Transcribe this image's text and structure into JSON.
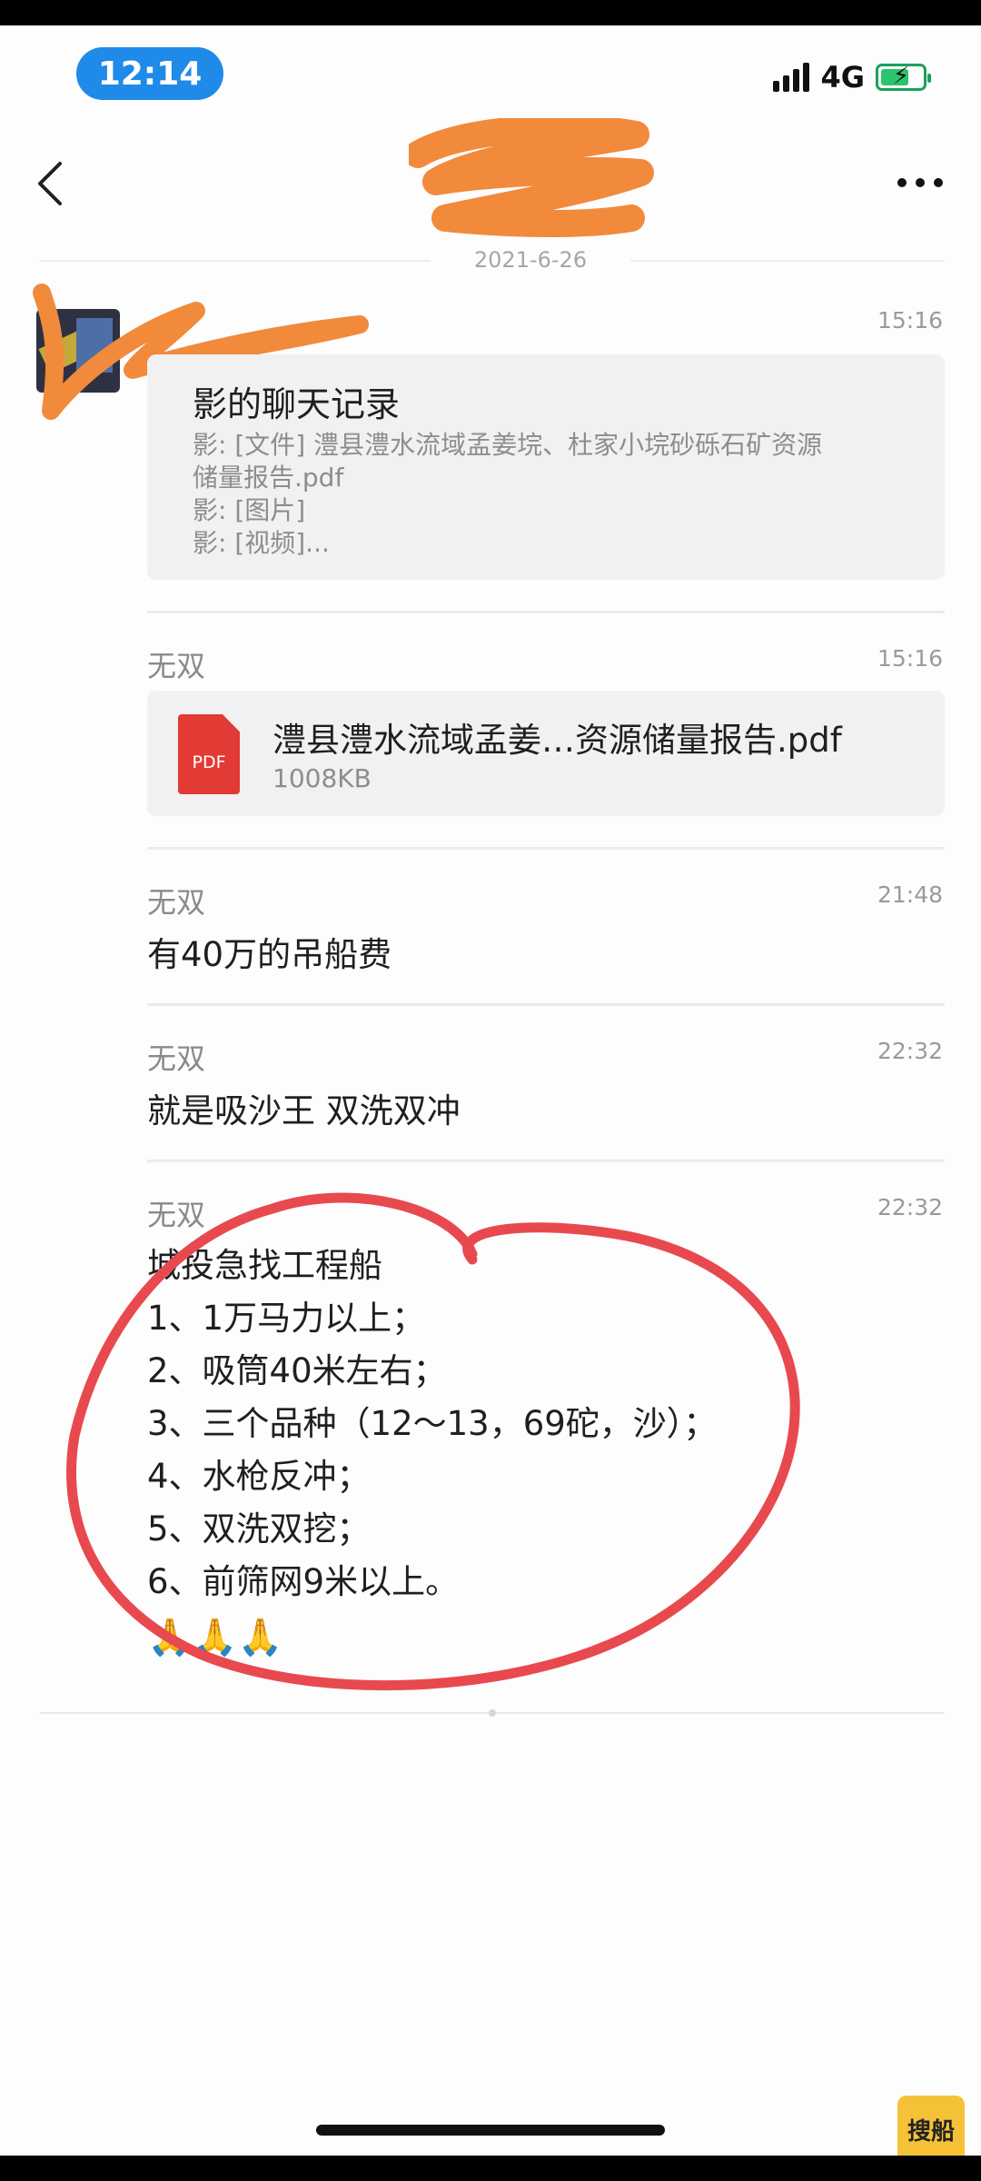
{
  "status": {
    "time": "12:14",
    "network": "4G"
  },
  "nav": {
    "title": ""
  },
  "date_separator": "2021-6-26",
  "messages": [
    {
      "sender": "",
      "time": "15:16",
      "card": {
        "title": "影的聊天记录",
        "lines": [
          "影: [文件] 澧县澧水流域孟姜垸、杜家小垸砂砾石矿资源",
          "储量报告.pdf",
          "影: [图片]",
          "影: [视频]..."
        ]
      }
    },
    {
      "sender": "无双",
      "time": "15:16",
      "file": {
        "icon_label": "PDF",
        "name": "澧县澧水流域孟姜…资源储量报告.pdf",
        "size": "1008KB"
      }
    },
    {
      "sender": "无双",
      "time": "21:48",
      "text": "有40万的吊船费"
    },
    {
      "sender": "无双",
      "time": "22:32",
      "text": "就是吸沙王 双洗双冲"
    },
    {
      "sender": "无双",
      "time": "22:32",
      "lines": [
        "城投急找工程船",
        "1、1万马力以上；",
        "2、吸筒40米左右；",
        "3、三个品种（12～13，69砣，沙）；",
        "4、水枪反冲；",
        "5、双洗双挖；",
        "6、前筛网9米以上。"
      ],
      "emoji": "🙏🙏🙏"
    }
  ],
  "watermark": "搜船",
  "colors": {
    "time_pill": "#1f8ae8",
    "annotation_circle": "#e8494f",
    "redaction": "#f28a3c",
    "pdf_icon": "#e23b35"
  }
}
